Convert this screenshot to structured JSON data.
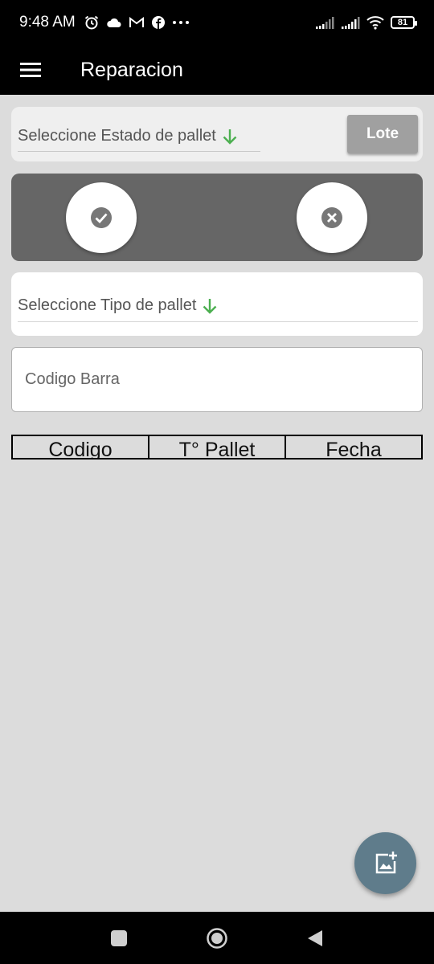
{
  "status_bar": {
    "time": "9:48 AM",
    "icons_left": [
      "alarm-icon",
      "cloud-icon",
      "gmail-icon",
      "facebook-icon",
      "more-dots-icon"
    ],
    "icons_right": [
      "signal-icon",
      "signal-icon",
      "wifi-icon",
      "battery-icon"
    ],
    "battery_level": "81"
  },
  "app_bar": {
    "title": "Reparacion",
    "menu_icon": "hamburger-icon"
  },
  "estado": {
    "select_label": "Seleccione Estado de pallet",
    "arrow_icon": "arrow-down-icon",
    "lote_button": "Lote"
  },
  "actions": {
    "confirm_icon": "check-circle-icon",
    "cancel_icon": "cancel-circle-icon"
  },
  "tipo": {
    "select_label": "Seleccione Tipo de pallet",
    "arrow_icon": "arrow-down-icon"
  },
  "barcode": {
    "placeholder": "Codigo Barra",
    "value": ""
  },
  "table": {
    "columns": [
      "Codigo",
      "T° Pallet",
      "Fecha"
    ],
    "rows": []
  },
  "fab": {
    "icon": "add-photo-icon"
  },
  "nav_bar": {
    "icons": [
      "recents-icon",
      "home-icon",
      "back-icon"
    ]
  },
  "colors": {
    "accent_green": "#4caf50",
    "action_panel": "#666666",
    "fab": "#5f7c8b",
    "background": "#dcdcdc"
  }
}
